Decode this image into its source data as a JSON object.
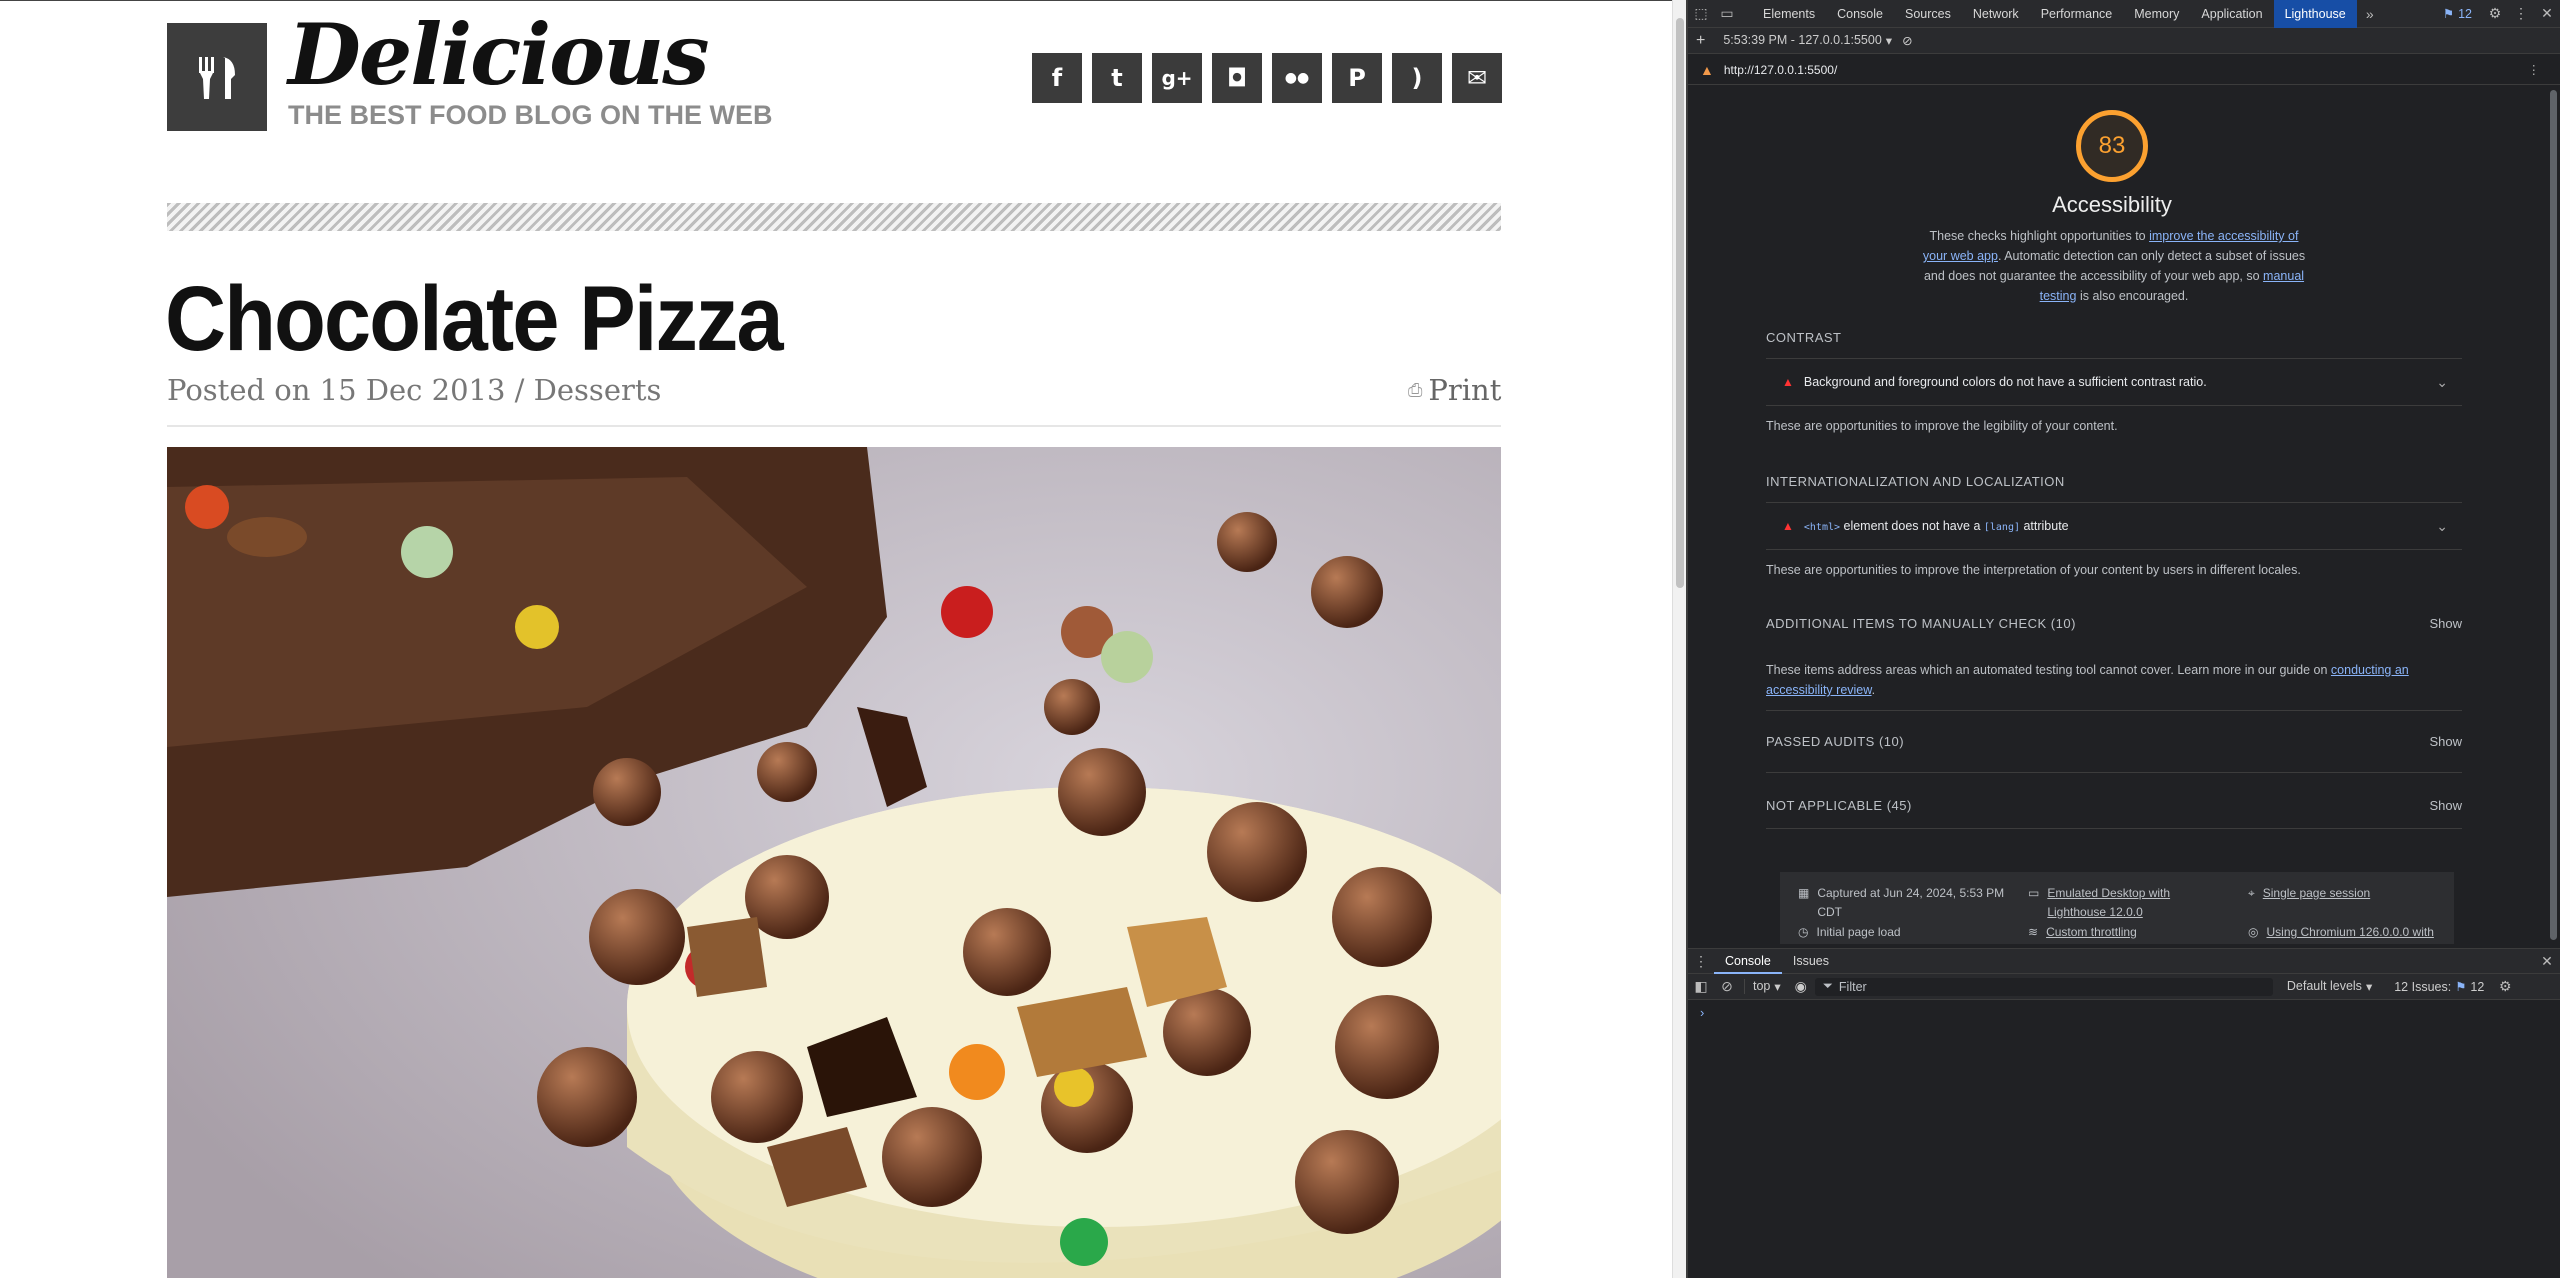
{
  "site": {
    "title": "Delicious",
    "tagline": "THE BEST FOOD BLOG ON THE WEB",
    "social": [
      {
        "icon": "facebook-icon",
        "glyph": "f"
      },
      {
        "icon": "twitter-icon",
        "glyph": "t"
      },
      {
        "icon": "google-plus-icon",
        "glyph": "g+"
      },
      {
        "icon": "instagram-icon",
        "glyph": "◘"
      },
      {
        "icon": "flickr-icon",
        "glyph": "●●"
      },
      {
        "icon": "pinterest-icon",
        "glyph": "P"
      },
      {
        "icon": "rss-icon",
        "glyph": ")"
      },
      {
        "icon": "email-icon",
        "glyph": "✉"
      }
    ]
  },
  "post": {
    "title": "Chocolate Pizza",
    "meta": "Posted on 15 Dec 2013 / Desserts",
    "print_label": "Print",
    "print_icon": "printer-icon"
  },
  "devtools": {
    "tabs": [
      "Elements",
      "Console",
      "Sources",
      "Network",
      "Performance",
      "Memory",
      "Application",
      "Lighthouse"
    ],
    "active_tab": "Lighthouse",
    "issues_count": "12",
    "report_select": "5:53:39 PM - 127.0.0.1:5500",
    "url": "http://127.0.0.1:5500/",
    "score": "83",
    "category": "Accessibility",
    "intro": {
      "pre": "These checks highlight opportunities to ",
      "link1": "improve the accessibility of your web app",
      "mid": ". Automatic detection can only detect a subset of issues and does not guarantee the accessibility of your web app, so ",
      "link2": "manual testing",
      "post": " is also encouraged."
    },
    "contrast": {
      "heading": "CONTRAST",
      "audit": "Background and foreground colors do not have a sufficient contrast ratio.",
      "desc": "These are opportunities to improve the legibility of your content."
    },
    "i18n": {
      "heading": "INTERNATIONALIZATION AND LOCALIZATION",
      "audit_code1": "<html>",
      "audit_mid": " element does not have a ",
      "audit_code2": "[lang]",
      "audit_post": " attribute",
      "desc": "These are opportunities to improve the interpretation of your content by users in different locales."
    },
    "manual": {
      "heading": "ADDITIONAL ITEMS TO MANUALLY CHECK (10)",
      "show": "Show",
      "desc_pre": "These items address areas which an automated testing tool cannot cover. Learn more in our guide on ",
      "desc_link": "conducting an accessibility review",
      "desc_post": "."
    },
    "passed": {
      "heading": "PASSED AUDITS (10)",
      "show": "Show"
    },
    "na": {
      "heading": "NOT APPLICABLE (45)",
      "show": "Show"
    },
    "summary": {
      "captured": "Captured at Jun 24, 2024, 5:53 PM CDT",
      "emulated": "Emulated Desktop with Lighthouse 12.0.0",
      "session": "Single page session",
      "initial": "Initial page load",
      "throttling": "Custom throttling",
      "chromium": "Using Chromium 126.0.0.0 with"
    },
    "drawer_tabs": [
      "Console",
      "Issues"
    ],
    "console": {
      "context": "top",
      "filter_placeholder": "Filter",
      "levels": "Default levels",
      "issues_label": "12 Issues:",
      "issues_count": "12",
      "prompt": "›"
    }
  },
  "colors": {
    "score_orange": "#fca130",
    "fail_red": "#ff3333",
    "link_blue": "#8ab4f8",
    "active_tab": "#174ea6"
  }
}
